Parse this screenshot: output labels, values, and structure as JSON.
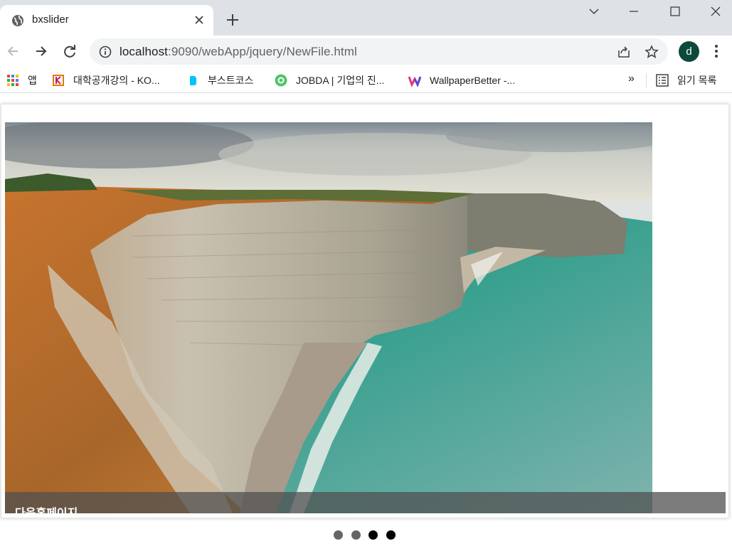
{
  "browser": {
    "tab": {
      "title": "bxslider"
    },
    "address_bar": {
      "host": "localhost",
      "path": ":9090/webApp/jquery/NewFile.html"
    },
    "profile_initial": "d"
  },
  "bookmarks": [
    {
      "label": "앱",
      "icon": "apps-grid-icon"
    },
    {
      "label": "대학공개강의 - KO...",
      "icon": "kocw-icon"
    },
    {
      "label": "부스트코스",
      "icon": "boostcourse-icon"
    },
    {
      "label": "JOBDA | 기업의 진...",
      "icon": "jobda-icon"
    },
    {
      "label": "WallpaperBetter -...",
      "icon": "wallpaperbetter-icon"
    }
  ],
  "bookmarks_more": "»",
  "reading_list": {
    "label": "읽기 목록",
    "icon": "reading-list-icon"
  },
  "slider": {
    "caption": "다음홈페이지",
    "pager": {
      "count": 4,
      "active_index": [
        2,
        3
      ]
    }
  },
  "colors": {
    "tabstrip": "#dee1e6",
    "avatar": "#0c4a3b",
    "pager_inactive": "#666666",
    "pager_active": "#000000"
  }
}
